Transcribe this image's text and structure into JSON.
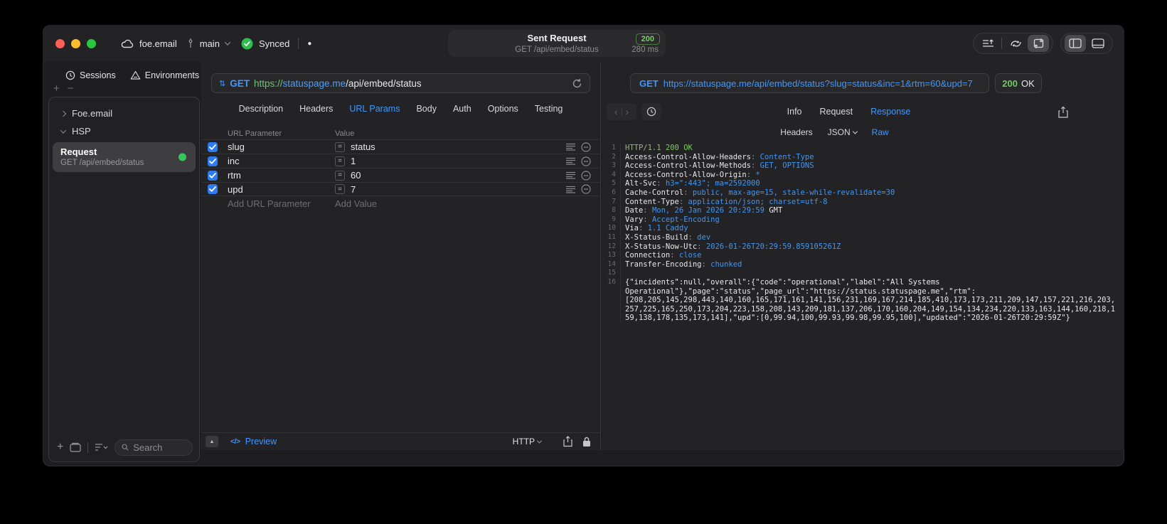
{
  "titlebar": {
    "workspace": "foe.email",
    "branch": "main",
    "sync_label": "Synced",
    "request_summary": {
      "title": "Sent Request",
      "status_code": "200",
      "method_path": "GET /api/embed/status",
      "duration": "280 ms"
    }
  },
  "sidebar": {
    "tabs": [
      {
        "label": "Sessions"
      },
      {
        "label": "Environments"
      }
    ],
    "tree": [
      {
        "label": "Foe.email",
        "expanded": false
      },
      {
        "label": "HSP",
        "expanded": true
      }
    ],
    "request_item": {
      "title": "Request",
      "subtitle": "GET /api/embed/status"
    },
    "search_placeholder": "Search"
  },
  "request_pane": {
    "method": "GET",
    "url": {
      "scheme": "https://",
      "host": "statuspage.me",
      "path": "/api/embed/status"
    },
    "tabs": [
      "Description",
      "Headers",
      "URL Params",
      "Body",
      "Auth",
      "Options",
      "Testing"
    ],
    "active_tab": "URL Params",
    "params": {
      "columns": [
        "URL Parameter",
        "Value"
      ],
      "rows": [
        {
          "name": "slug",
          "value": "status",
          "enabled": true
        },
        {
          "name": "inc",
          "value": "1",
          "enabled": true
        },
        {
          "name": "rtm",
          "value": "60",
          "enabled": true
        },
        {
          "name": "upd",
          "value": "7",
          "enabled": true
        }
      ],
      "add_name": "Add URL Parameter",
      "add_value": "Add Value"
    },
    "footer": {
      "preview": "Preview",
      "preview_glyph": "</>",
      "protocol": "HTTP"
    }
  },
  "response_pane": {
    "method": "GET",
    "url": "https://statuspage.me/api/embed/status?slug=status&inc=1&rtm=60&upd=7",
    "status": {
      "code": "200",
      "text": "OK"
    },
    "tabs": [
      "Info",
      "Request",
      "Response"
    ],
    "active_tab": "Response",
    "subtabs": [
      {
        "label": "Headers"
      },
      {
        "label": "JSON",
        "dropdown": true
      },
      {
        "label": "Raw"
      }
    ],
    "active_subtab": "Raw",
    "raw_lines": [
      {
        "n": "1",
        "parts": [
          [
            "HTTP/1.1 ",
            "proto"
          ],
          [
            "200 OK",
            "ok"
          ]
        ]
      },
      {
        "n": "2",
        "parts": [
          [
            "Access-Control-Allow-Headers",
            "k"
          ],
          [
            ": ",
            "p"
          ],
          [
            "Content-Type",
            "v"
          ]
        ]
      },
      {
        "n": "3",
        "parts": [
          [
            "Access-Control-Allow-Methods",
            "k"
          ],
          [
            ": ",
            "p"
          ],
          [
            "GET, OPTIONS",
            "v"
          ]
        ]
      },
      {
        "n": "4",
        "parts": [
          [
            "Access-Control-Allow-Origin",
            "k"
          ],
          [
            ": ",
            "p"
          ],
          [
            "*",
            "v"
          ]
        ]
      },
      {
        "n": "5",
        "parts": [
          [
            "Alt-Svc",
            "k"
          ],
          [
            ": ",
            "p"
          ],
          [
            "h3=\":443\"; ma=2592000",
            "v"
          ]
        ]
      },
      {
        "n": "6",
        "parts": [
          [
            "Cache-Control",
            "k"
          ],
          [
            ": ",
            "p"
          ],
          [
            "public, max-age=15, stale-while-revalidate=30",
            "v"
          ]
        ]
      },
      {
        "n": "7",
        "parts": [
          [
            "Content-Type",
            "k"
          ],
          [
            ": ",
            "p"
          ],
          [
            "application/json; charset=utf-8",
            "v"
          ]
        ]
      },
      {
        "n": "8",
        "parts": [
          [
            "Date",
            "k"
          ],
          [
            ": ",
            "p"
          ],
          [
            "Mon, 26 Jan 2026 20:29:59 ",
            "v"
          ],
          [
            "GMT",
            "k"
          ]
        ]
      },
      {
        "n": "9",
        "parts": [
          [
            "Vary",
            "k"
          ],
          [
            ": ",
            "p"
          ],
          [
            "Accept-Encoding",
            "v"
          ]
        ]
      },
      {
        "n": "10",
        "parts": [
          [
            "Via",
            "k"
          ],
          [
            ": ",
            "p"
          ],
          [
            "1.1 Caddy",
            "v"
          ]
        ]
      },
      {
        "n": "11",
        "parts": [
          [
            "X-Status-Build",
            "k"
          ],
          [
            ": ",
            "p"
          ],
          [
            "dev",
            "v"
          ]
        ]
      },
      {
        "n": "12",
        "parts": [
          [
            "X-Status-Now-Utc",
            "k"
          ],
          [
            ": ",
            "p"
          ],
          [
            "2026-01-26T20:29:59.859105261Z",
            "v"
          ]
        ]
      },
      {
        "n": "13",
        "parts": [
          [
            "Connection",
            "k"
          ],
          [
            ": ",
            "p"
          ],
          [
            "close",
            "v"
          ]
        ]
      },
      {
        "n": "14",
        "parts": [
          [
            "Transfer-Encoding",
            "k"
          ],
          [
            ": ",
            "p"
          ],
          [
            "chunked",
            "v"
          ]
        ]
      },
      {
        "n": "15",
        "parts": []
      },
      {
        "n": "16",
        "parts": [
          [
            "{\"incidents\":null,\"overall\":{\"code\":\"operational\",\"label\":\"All Systems Operational\"},\"page\":\"status\",\"page_url\":\"https://status.statuspage.me\",\"rtm\":[208,205,145,298,443,140,160,165,171,161,141,156,231,169,167,214,185,410,173,173,211,209,147,157,221,216,203,257,225,165,250,173,204,223,158,208,143,209,181,137,206,170,160,204,149,154,134,234,220,133,163,144,160,218,159,138,178,135,173,141],\"upd\":[0,99.94,100,99.93,99.98,99.95,100],\"updated\":\"2026-01-26T20:29:59Z\"}",
            "body"
          ]
        ]
      }
    ]
  },
  "icons": {
    "method_updown": "⇅",
    "equals": "=",
    "collapse": "▲",
    "plus": "+",
    "minus": "−",
    "nav_back": "‹",
    "nav_forward": "›",
    "unsaved_dot": "●"
  },
  "colors": {
    "accent_blue": "#3f97ff",
    "green": "#6fce62",
    "checkbox_blue": "#2e7bef",
    "status_dot": "#34c759"
  }
}
